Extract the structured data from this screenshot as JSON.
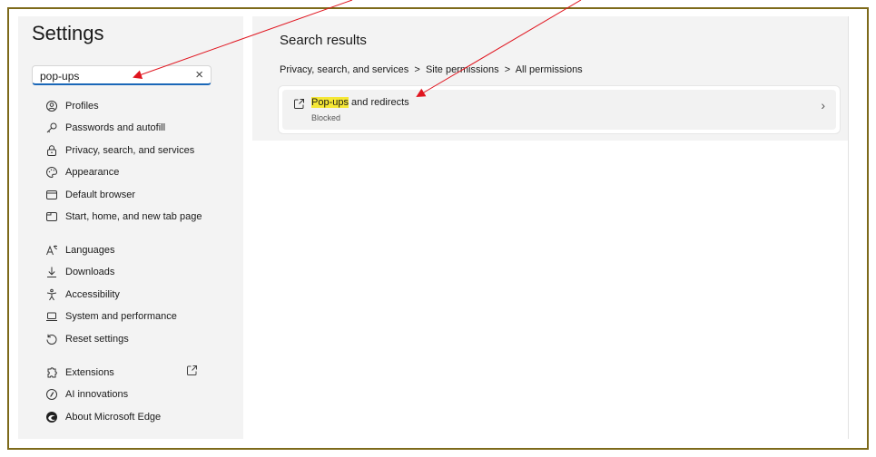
{
  "settings_title": "Settings",
  "search": {
    "value": "pop-ups",
    "clear_glyph": "×"
  },
  "sidebar": {
    "items": [
      {
        "label": "Profiles",
        "icon": "profile-icon"
      },
      {
        "label": "Passwords and autofill",
        "icon": "key-icon"
      },
      {
        "label": "Privacy, search, and services",
        "icon": "lock-icon"
      },
      {
        "label": "Appearance",
        "icon": "palette-icon"
      },
      {
        "label": "Default browser",
        "icon": "browser-icon"
      },
      {
        "label": "Start, home, and new tab page",
        "icon": "home-tab-icon"
      },
      {
        "label": "Languages",
        "icon": "languages-icon"
      },
      {
        "label": "Downloads",
        "icon": "download-icon"
      },
      {
        "label": "Accessibility",
        "icon": "accessibility-icon"
      },
      {
        "label": "System and performance",
        "icon": "laptop-icon"
      },
      {
        "label": "Reset settings",
        "icon": "reset-icon"
      },
      {
        "label": "Extensions",
        "icon": "extensions-icon"
      },
      {
        "label": "AI innovations",
        "icon": "ai-icon"
      },
      {
        "label": "About Microsoft Edge",
        "icon": "edge-logo-icon"
      }
    ]
  },
  "main": {
    "results_title": "Search results",
    "breadcrumb": {
      "part1": "Privacy, search, and services",
      "sep": ">",
      "part2": "Site permissions",
      "part3": "All permissions"
    },
    "result": {
      "title_highlight": "Pop-ups",
      "title_rest": " and redirects",
      "subtitle": "Blocked"
    }
  },
  "colors": {
    "annotation_arrow": "#e0141e",
    "highlight": "#f5e735",
    "frame_border": "#7d6a1a"
  }
}
